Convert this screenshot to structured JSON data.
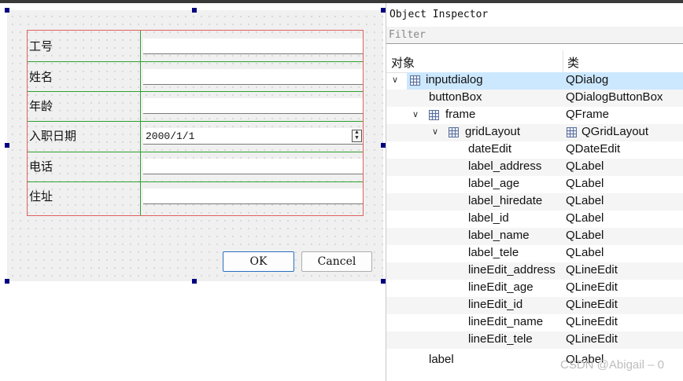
{
  "form": {
    "labels": [
      "工号",
      "姓名",
      "年龄",
      "入职日期",
      "电话",
      "住址"
    ],
    "date_value": "2000/1/1",
    "spin_up": "▲",
    "spin_down": "▼",
    "ok_label": "OK",
    "cancel_label": "Cancel"
  },
  "inspector": {
    "title": "Object Inspector",
    "filter_placeholder": "Filter",
    "col_object": "对象",
    "col_class": "类",
    "expand_glyph": "∨",
    "rows": [
      {
        "object": "inputdialog",
        "class": "QDialog"
      },
      {
        "object": "buttonBox",
        "class": "QDialogButtonBox"
      },
      {
        "object": "frame",
        "class": "QFrame"
      },
      {
        "object": "gridLayout",
        "class": "QGridLayout"
      },
      {
        "object": "dateEdit",
        "class": "QDateEdit"
      },
      {
        "object": "label_address",
        "class": "QLabel"
      },
      {
        "object": "label_age",
        "class": "QLabel"
      },
      {
        "object": "label_hiredate",
        "class": "QLabel"
      },
      {
        "object": "label_id",
        "class": "QLabel"
      },
      {
        "object": "label_name",
        "class": "QLabel"
      },
      {
        "object": "label_tele",
        "class": "QLabel"
      },
      {
        "object": "lineEdit_address",
        "class": "QLineEdit"
      },
      {
        "object": "lineEdit_age",
        "class": "QLineEdit"
      },
      {
        "object": "lineEdit_id",
        "class": "QLineEdit"
      },
      {
        "object": "lineEdit_name",
        "class": "QLineEdit"
      },
      {
        "object": "lineEdit_tele",
        "class": "QLineEdit"
      },
      {
        "object": "label",
        "class": "QLabel"
      }
    ]
  },
  "watermark": "CSDN @Abigail – 0",
  "colors": {
    "selection": "#cce8ff",
    "frame_border": "#e06060",
    "grid_lines": "#2fa02f",
    "handle": "#000080"
  }
}
